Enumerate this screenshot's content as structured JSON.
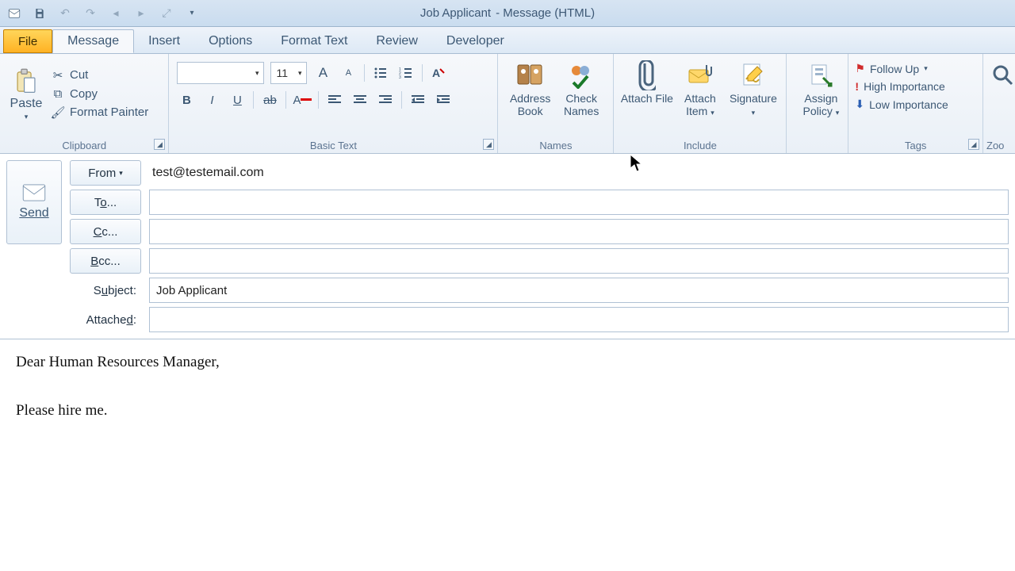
{
  "window": {
    "doc_title": "Job Applicant",
    "app_suffix": " -  Message (HTML)"
  },
  "tabs": {
    "file": "File",
    "message": "Message",
    "insert": "Insert",
    "options": "Options",
    "format": "Format Text",
    "review": "Review",
    "developer": "Developer"
  },
  "clipboard": {
    "paste": "Paste",
    "cut": "Cut",
    "copy": "Copy",
    "painter": "Format Painter",
    "group": "Clipboard"
  },
  "basic_text": {
    "font_name": "",
    "font_size": "11",
    "group": "Basic Text"
  },
  "names": {
    "address": "Address Book",
    "check": "Check Names",
    "group": "Names"
  },
  "include": {
    "attach_file": "Attach File",
    "attach_item": "Attach Item",
    "signature": "Signature",
    "group": "Include"
  },
  "assign": {
    "assign_policy": "Assign Policy"
  },
  "tags": {
    "follow": "Follow Up",
    "high": "High Importance",
    "low": "Low Importance",
    "group": "Tags"
  },
  "zoom": {
    "label": "Zoo"
  },
  "compose": {
    "send": "Send",
    "from_btn": "From",
    "from_value": "test@testemail.com",
    "to_btn": "To...",
    "cc_btn": "Cc...",
    "bcc_btn": "Bcc...",
    "subject_lbl": "Subject:",
    "subject_value": "Job Applicant",
    "attached_lbl": "Attached:",
    "to_value": "",
    "cc_value": "",
    "bcc_value": "",
    "attached_value": ""
  },
  "body": {
    "text": "Dear Human Resources Manager,\n\nPlease hire me."
  }
}
